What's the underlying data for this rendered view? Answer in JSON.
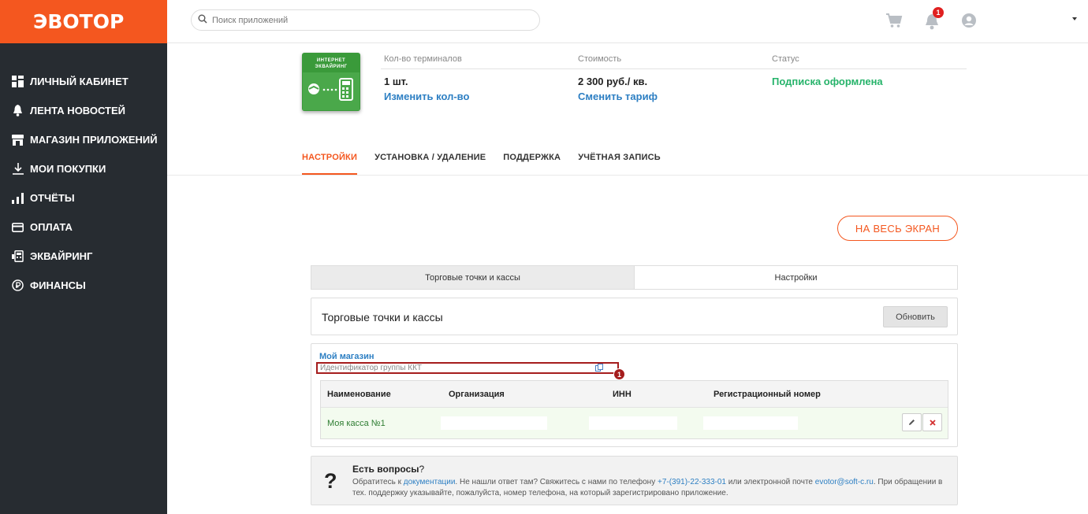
{
  "brand": {
    "logo": "ЭВОТОР",
    "accent": "#f4571f"
  },
  "sidebar": {
    "items": [
      {
        "label": "ЛИЧНЫЙ КАБИНЕТ",
        "icon": "dashboard-icon"
      },
      {
        "label": "ЛЕНТА НОВОСТЕЙ",
        "icon": "bell-icon"
      },
      {
        "label": "МАГАЗИН ПРИЛОЖЕНИЙ",
        "icon": "store-icon"
      },
      {
        "label": "МОИ ПОКУПКИ",
        "icon": "download-icon"
      },
      {
        "label": "ОТЧЁТЫ",
        "icon": "bar-chart-icon"
      },
      {
        "label": "ОПЛАТА",
        "icon": "card-icon"
      },
      {
        "label": "ЭКВАЙРИНГ",
        "icon": "terminal-icon"
      },
      {
        "label": "ФИНАНСЫ",
        "icon": "ruble-icon"
      }
    ]
  },
  "topbar": {
    "search_placeholder": "Поиск приложений",
    "notifications_count": "1"
  },
  "product": {
    "icon_text_line1": "ИНТЕРНЕТ",
    "icon_text_line2": "ЭКВАЙРИНГ",
    "terminals_label": "Кол-во терминалов",
    "terminals_value": "1 шт.",
    "terminals_link": "Изменить кол-во",
    "price_label": "Стоимость",
    "price_value": "2 300 руб./ кв.",
    "price_link": "Сменить тариф",
    "status_label": "Статус",
    "status_value": "Подписка оформлена"
  },
  "tabs": [
    {
      "label": "НАСТРОЙКИ",
      "active": true
    },
    {
      "label": "УСТАНОВКА / УДАЛЕНИЕ"
    },
    {
      "label": "ПОДДЕРЖКА"
    },
    {
      "label": "УЧЁТНАЯ ЗАПИСЬ"
    }
  ],
  "fullscreen_label": "НА ВЕСЬ ЭКРАН",
  "subtabs": [
    "Торговые точки и кассы",
    "Настройки"
  ],
  "panel": {
    "title": "Торговые точки и кассы",
    "refresh_label": "Обновить",
    "store_name": "Мой магазин",
    "group_id_placeholder": "Идентификатор группы ККТ",
    "annotation_badge": "1",
    "table": {
      "columns": [
        "Наименование",
        "Организация",
        "ИНН",
        "Регистрационный номер"
      ],
      "rows": [
        {
          "name": "Моя касса №1"
        }
      ]
    }
  },
  "help": {
    "title": "Есть вопросы",
    "title_suffix": "?",
    "text_1": "Обратитесь к ",
    "docs_link": "документации",
    "text_2": ". Не нашли ответ там? Свяжитесь с нами по телефону ",
    "phone": "+7-(391)-22-333-01",
    "text_3": " или электронной почте ",
    "email": "evotor@soft-c.ru",
    "text_4": ". При обращении в тех. поддержку указывайте, пожалуйста, номер телефона, на который зарегистрировано приложение."
  }
}
